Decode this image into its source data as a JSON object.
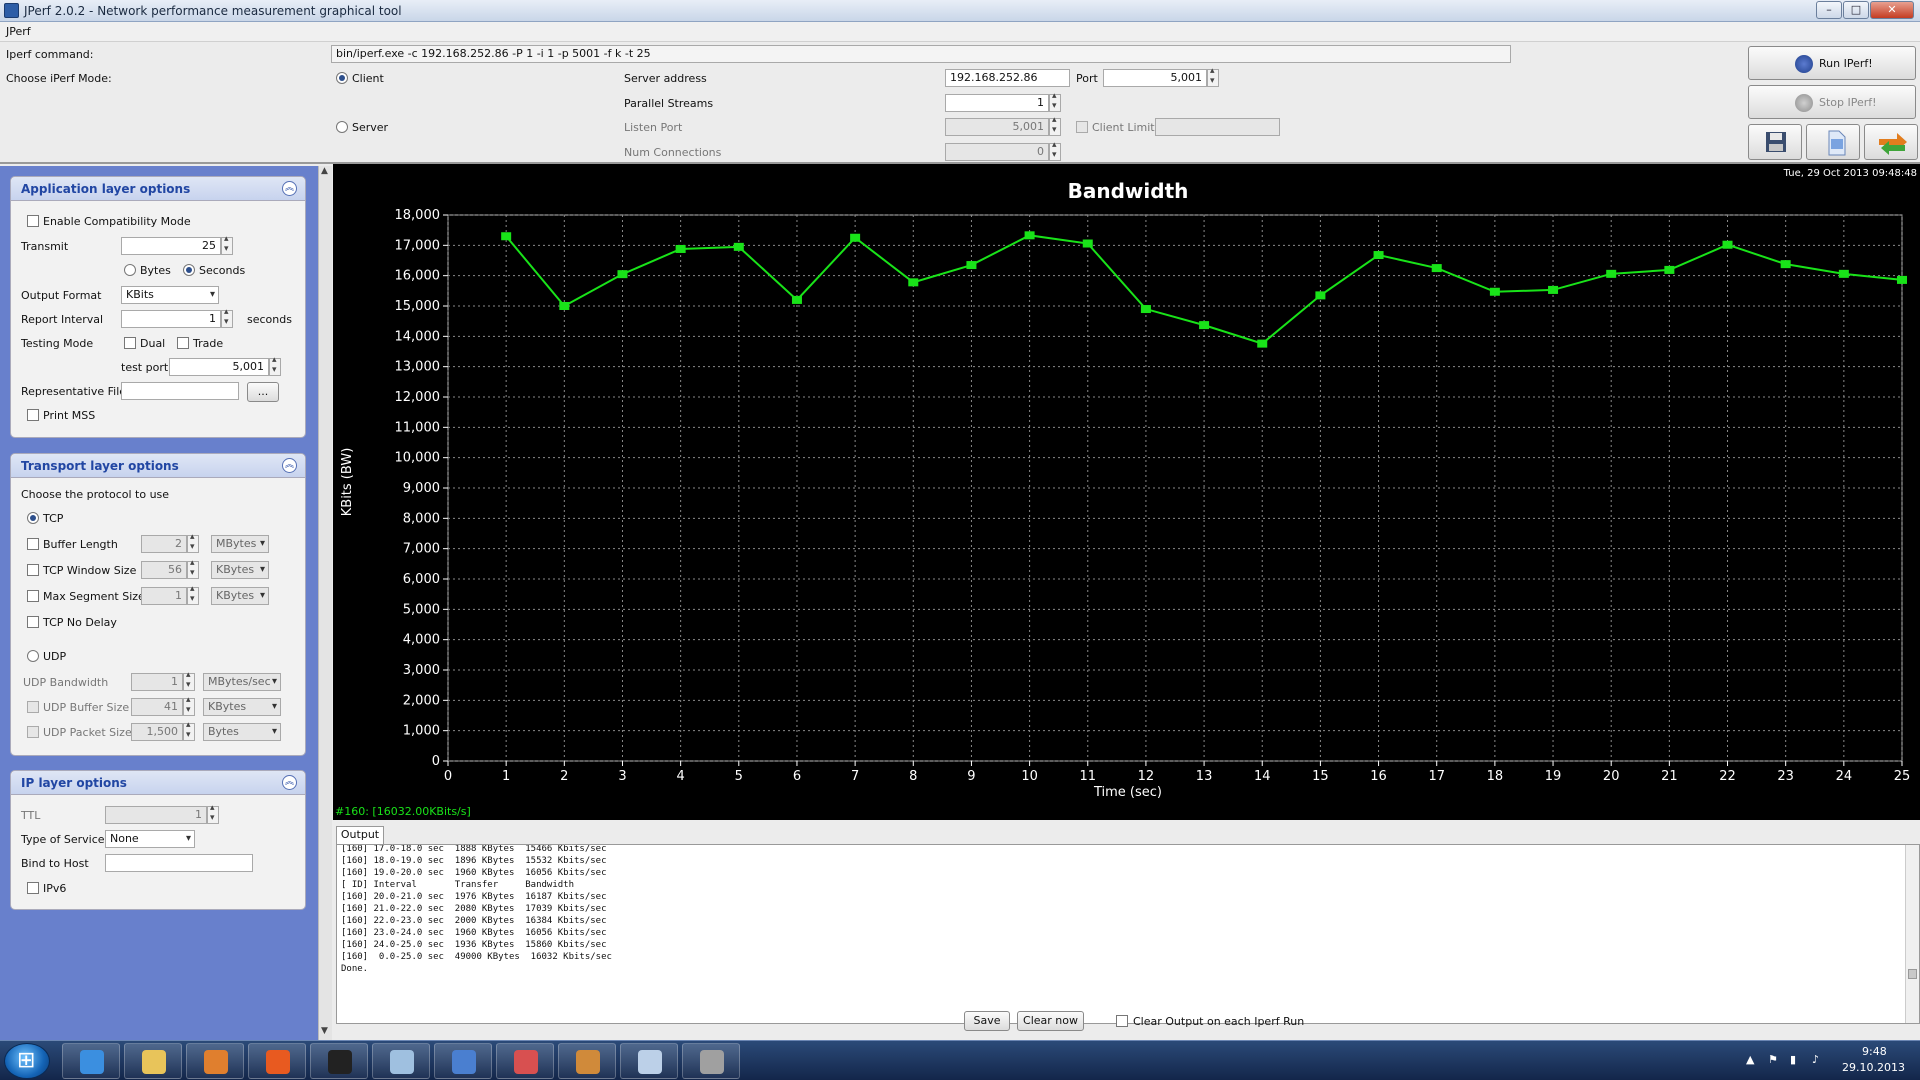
{
  "window": {
    "title": "JPerf 2.0.2 - Network performance measurement graphical tool",
    "min": "–",
    "max": "□",
    "close": "✕"
  },
  "menu": {
    "jperf": "JPerf"
  },
  "top": {
    "iperf_command_label": "Iperf command:",
    "iperf_command": "bin/iperf.exe -c 192.168.252.86 -P 1 -i 1 -p 5001 -f k -t 25",
    "mode_label": "Choose iPerf Mode:",
    "client_label": "Client",
    "server_label": "Server",
    "server_address_label": "Server address",
    "server_address": "192.168.252.86",
    "port_label": "Port",
    "port": "5,001",
    "parallel_label": "Parallel Streams",
    "parallel": "1",
    "listen_port_label": "Listen Port",
    "listen_port": "5,001",
    "client_limit_label": "Client Limit",
    "num_conn_label": "Num Connections",
    "num_conn": "0",
    "run_label": "Run IPerf!",
    "stop_label": "Stop IPerf!",
    "timestamp": "Tue, 29 Oct 2013 09:48:48"
  },
  "app_layer": {
    "title": "Application layer options",
    "compat_label": "Enable Compatibility Mode",
    "transmit_label": "Transmit",
    "transmit": "25",
    "bytes_label": "Bytes",
    "seconds_label": "Seconds",
    "output_format_label": "Output Format",
    "output_format": "KBits",
    "report_interval_label": "Report Interval",
    "report_interval": "1",
    "seconds_unit": "seconds",
    "testing_mode_label": "Testing Mode",
    "dual_label": "Dual",
    "trade_label": "Trade",
    "test_port_label": "test port",
    "test_port": "5,001",
    "rep_file_label": "Representative File",
    "browse_label": "...",
    "print_mss_label": "Print MSS"
  },
  "transport": {
    "title": "Transport layer options",
    "choose_label": "Choose the protocol to use",
    "tcp_label": "TCP",
    "buffer_length_label": "Buffer Length",
    "buffer_length": "2",
    "buffer_unit": "MBytes",
    "tcp_window_label": "TCP Window Size",
    "tcp_window": "56",
    "tcp_window_unit": "KBytes",
    "mss_label": "Max Segment Size",
    "mss": "1",
    "mss_unit": "KBytes",
    "nodelay_label": "TCP No Delay",
    "udp_label": "UDP",
    "udp_bw_label": "UDP Bandwidth",
    "udp_bw": "1",
    "udp_bw_unit": "MBytes/sec",
    "udp_buf_label": "UDP Buffer Size",
    "udp_buf": "41",
    "udp_buf_unit": "KBytes",
    "udp_pkt_label": "UDP Packet Size",
    "udp_pkt": "1,500",
    "udp_pkt_unit": "Bytes"
  },
  "ip_layer": {
    "title": "IP layer options",
    "ttl_label": "TTL",
    "ttl": "1",
    "tos_label": "Type of Service",
    "tos": "None",
    "bind_label": "Bind to Host",
    "ipv6_label": "IPv6"
  },
  "chart_data": {
    "type": "line",
    "title": "Bandwidth",
    "xlabel": "Time (sec)",
    "ylabel": "KBits (BW)",
    "xlim": [
      0,
      25
    ],
    "ylim": [
      0,
      18000
    ],
    "x_ticks": [
      "0",
      "1",
      "2",
      "3",
      "4",
      "5",
      "6",
      "7",
      "8",
      "9",
      "10",
      "11",
      "12",
      "13",
      "14",
      "15",
      "16",
      "17",
      "18",
      "19",
      "20",
      "21",
      "22",
      "23",
      "24",
      "25"
    ],
    "y_ticks": [
      "0",
      "1,000",
      "2,000",
      "3,000",
      "4,000",
      "5,000",
      "6,000",
      "7,000",
      "8,000",
      "9,000",
      "10,000",
      "11,000",
      "12,000",
      "13,000",
      "14,000",
      "15,000",
      "16,000",
      "17,000",
      "18,000"
    ],
    "grid": true,
    "series": [
      {
        "color": "#19e319",
        "x": [
          1,
          2,
          3,
          4,
          5,
          6,
          7,
          8,
          9,
          10,
          11,
          12,
          13,
          14,
          15,
          16,
          17,
          18,
          19,
          20,
          21,
          22,
          23,
          24,
          25
        ],
        "y": [
          17300,
          15000,
          16050,
          16880,
          16950,
          15200,
          17250,
          15780,
          16350,
          17330,
          17060,
          14900,
          14370,
          13760,
          15350,
          16680,
          16250,
          15470,
          15530,
          16060,
          16190,
          17020,
          16380,
          16060,
          15860
        ]
      }
    ],
    "status": "#160: [16032.00KBits/s]"
  },
  "output": {
    "tab_label": "Output",
    "lines": [
      "[160] 17.0-18.0 sec  1888 KBytes  15466 Kbits/sec",
      "[160] 18.0-19.0 sec  1896 KBytes  15532 Kbits/sec",
      "[160] 19.0-20.0 sec  1960 KBytes  16056 Kbits/sec",
      "[ ID] Interval       Transfer     Bandwidth",
      "[160] 20.0-21.0 sec  1976 KBytes  16187 Kbits/sec",
      "[160] 21.0-22.0 sec  2080 KBytes  17039 Kbits/sec",
      "[160] 22.0-23.0 sec  2000 KBytes  16384 Kbits/sec",
      "[160] 23.0-24.0 sec  1960 KBytes  16056 Kbits/sec",
      "[160] 24.0-25.0 sec  1936 KBytes  15860 Kbits/sec",
      "[160]  0.0-25.0 sec  49000 KBytes  16032 Kbits/sec",
      "Done."
    ],
    "save_label": "Save",
    "clear_label": "Clear now",
    "clear_each_label": "Clear Output on each Iperf Run"
  },
  "taskbar": {
    "time": "9:48",
    "date": "29.10.2013",
    "icons": [
      "ie-icon",
      "explorer-icon",
      "media-player-icon",
      "firefox-icon",
      "cmd-icon",
      "notepad-icon",
      "network-icon",
      "paint-icon",
      "java-icon",
      "jperf-icon",
      "xming-icon"
    ]
  }
}
